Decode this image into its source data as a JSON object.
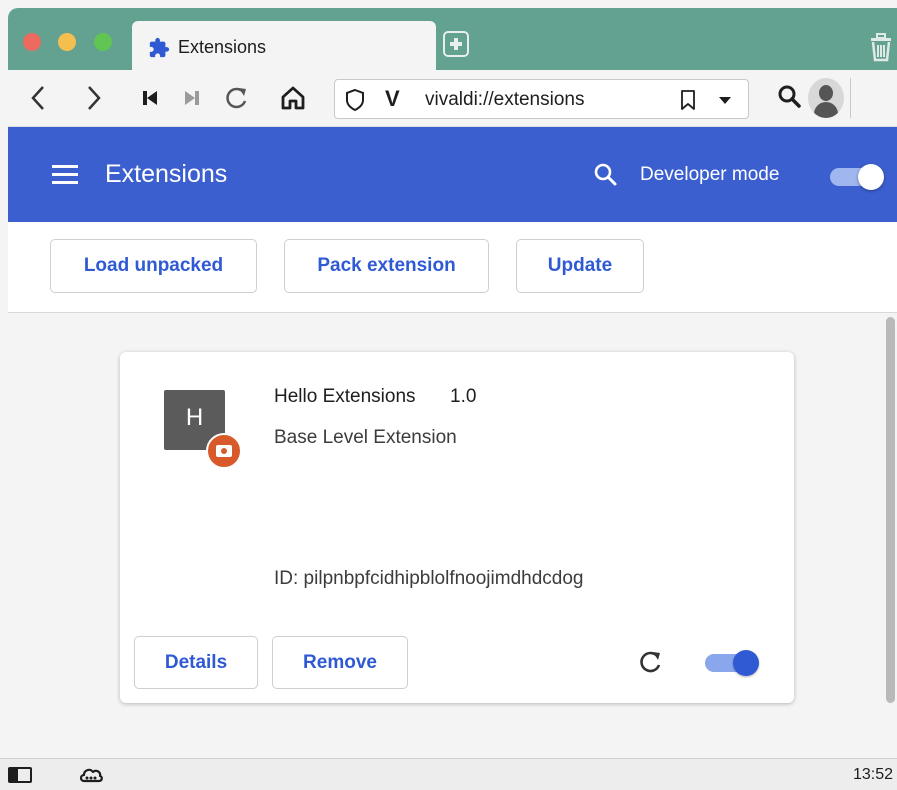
{
  "browser": {
    "tab": {
      "title": "Extensions",
      "icon": "puzzle-icon"
    },
    "address_bar": {
      "url": "vivaldi://extensions"
    }
  },
  "header": {
    "title": "Extensions",
    "developer_mode_label": "Developer mode",
    "developer_mode_on": true
  },
  "actions": {
    "load_unpacked": "Load unpacked",
    "pack_extension": "Pack extension",
    "update": "Update"
  },
  "extension": {
    "icon_letter": "H",
    "name": "Hello Extensions",
    "version": "1.0",
    "description": "Base Level Extension",
    "id_text": "ID: pilpnbpfcidhipblolfnoojimdhdcdog",
    "details_label": "Details",
    "remove_label": "Remove",
    "enabled": true
  },
  "status_bar": {
    "time": "13:52"
  },
  "colors": {
    "tab_bar": "#63a191",
    "header": "#3c5fd0",
    "accent": "#2f5ad4",
    "badge": "#d85a2a"
  }
}
